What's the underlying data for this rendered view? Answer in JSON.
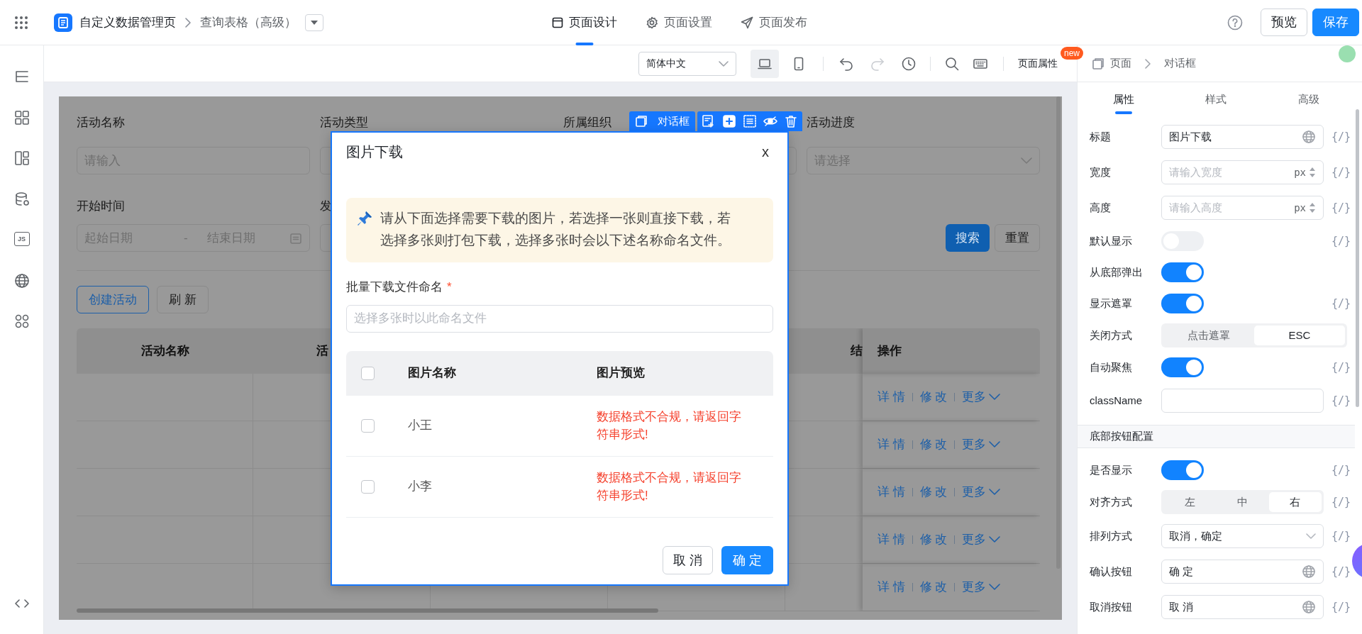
{
  "app_bar": {
    "title": "自定义数据管理页",
    "page": "查询表格（高级）",
    "tabs": [
      {
        "label": "页面设计",
        "kind": "design",
        "selected": true
      },
      {
        "label": "页面设置",
        "kind": "settings",
        "selected": false
      },
      {
        "label": "页面发布",
        "kind": "publish",
        "selected": false
      }
    ],
    "buttons": [
      {
        "label": "预览",
        "kind": "default"
      },
      {
        "label": "保存",
        "kind": "primary"
      }
    ]
  },
  "left_sidebar": {
    "script_label": "JS"
  },
  "toolbar": {
    "language": "简体中文",
    "devices": [
      {
        "kind": "desktop",
        "selected": true
      },
      {
        "kind": "mobile",
        "selected": false
      }
    ],
    "history": [
      {
        "kind": "undo",
        "disabled": false
      },
      {
        "kind": "redo",
        "disabled": true
      }
    ],
    "page_properties": "页面属性",
    "badge": "new"
  },
  "canvas": {
    "filters": [
      {
        "label": "活动名称",
        "placeholder": "请输入",
        "kind": "text"
      },
      {
        "label": "活动类型",
        "kind": "text"
      },
      {
        "label": "所属组织",
        "kind": "text"
      },
      {
        "label": "活动进度",
        "placeholder": "请选择",
        "kind": "select"
      }
    ],
    "filters_row_2": [
      {
        "label": "开始时间",
        "kind": "range",
        "start_placeholder": "起始日期",
        "separator": "-",
        "end_placeholder": "结束日期"
      },
      {
        "label": "发",
        "kind": "text"
      }
    ],
    "search_buttons": [
      {
        "label": "搜索",
        "kind": "primary"
      },
      {
        "label": "重置",
        "kind": "default"
      }
    ],
    "actions": [
      {
        "label": "创建活动",
        "kind": "primary"
      },
      {
        "label": "刷 新",
        "kind": "default"
      }
    ],
    "table": {
      "columns": [
        {
          "label": "活动名称"
        },
        {
          "label": "活"
        },
        {
          "label": "结"
        },
        {
          "label": "操作"
        }
      ],
      "rows": [
        {
          "actions": [
            "详 情",
            "修 改",
            "更多"
          ]
        },
        {
          "actions": [
            "详 情",
            "修 改",
            "更多"
          ]
        },
        {
          "actions": [
            "详 情",
            "修 改",
            "更多"
          ]
        },
        {
          "actions": [
            "详 情",
            "修 改",
            "更多"
          ]
        },
        {
          "actions": [
            "详 情",
            "修 改",
            "更多"
          ]
        }
      ]
    }
  },
  "dialog": {
    "tag": "对话框",
    "title": "图片下载",
    "close": "x",
    "notice": "请从下面选择需要下载的图片，若选择一张则直接下载，若选择多张则打包下载，选择多张时会以下述名称命名文件。",
    "field": {
      "label": "批量下载文件命名",
      "required": "*",
      "placeholder": "选择多张时以此命名文件"
    },
    "table": {
      "columns": [
        "图片名称",
        "图片预览"
      ],
      "all_checked": false,
      "rows": [
        {
          "name": "小王",
          "preview": "数据格式不合规，请返回字符串形式!",
          "checked": false
        },
        {
          "name": "小李",
          "preview": "数据格式不合规，请返回字符串形式!",
          "checked": false
        }
      ]
    },
    "buttons": [
      {
        "label": "取 消",
        "kind": "default"
      },
      {
        "label": "确 定",
        "kind": "primary"
      }
    ]
  },
  "properties_panel": {
    "breadcrumb": [
      "页面",
      "对话框"
    ],
    "tabs": [
      {
        "label": "属性",
        "selected": true
      },
      {
        "label": "样式",
        "selected": false
      },
      {
        "label": "高级",
        "selected": false
      }
    ],
    "rows": [
      {
        "kind": "input",
        "label": "标题",
        "value": "图片下载",
        "translatable": true,
        "binding": "{/}"
      },
      {
        "kind": "input",
        "label": "宽度",
        "placeholder": "请输入宽度",
        "unit": "px",
        "binding": "{/}"
      },
      {
        "kind": "input",
        "label": "高度",
        "placeholder": "请输入高度",
        "unit": "px",
        "binding": "{/}"
      },
      {
        "kind": "toggle",
        "label": "默认显示",
        "on": false,
        "binding": "{/}"
      },
      {
        "kind": "toggle",
        "label": "从底部弹出",
        "on": true
      },
      {
        "kind": "toggle",
        "label": "显示遮罩",
        "on": true,
        "binding": "{/}"
      },
      {
        "kind": "segment",
        "label": "关闭方式",
        "options": [
          {
            "label": "点击遮罩",
            "selected": false
          },
          {
            "label": "ESC",
            "selected": true
          }
        ]
      },
      {
        "kind": "toggle",
        "label": "自动聚焦",
        "on": true,
        "binding": "{/}"
      },
      {
        "kind": "input",
        "label": "className",
        "binding": "{/}"
      },
      {
        "kind": "section",
        "label": "底部按钮配置"
      },
      {
        "kind": "toggle",
        "label": "是否显示",
        "on": true,
        "binding": "{/}"
      },
      {
        "kind": "segment",
        "label": "对齐方式",
        "options": [
          {
            "label": "左",
            "selected": false
          },
          {
            "label": "中",
            "selected": false
          },
          {
            "label": "右",
            "selected": true
          }
        ],
        "binding": "{/}"
      },
      {
        "kind": "select",
        "label": "排列方式",
        "value": "取消，确定",
        "binding": "{/}"
      },
      {
        "kind": "input",
        "label": "确认按钮",
        "value": "确 定",
        "translatable": true,
        "binding": "{/}"
      },
      {
        "kind": "input",
        "label": "取消按钮",
        "value": "取 消",
        "translatable": true,
        "binding": "{/}"
      }
    ]
  }
}
